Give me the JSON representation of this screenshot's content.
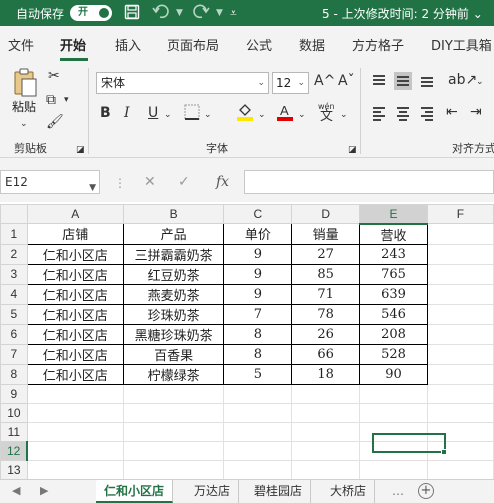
{
  "titlebar": {
    "autosave_label": "自动保存",
    "autosave_toggle": "开",
    "doc_status": "5 - 上次修改时间: 2 分钟前 ⌄"
  },
  "ribbon_tabs": [
    "文件",
    "开始",
    "插入",
    "页面布局",
    "公式",
    "数据",
    "方方格子",
    "DIY工具箱"
  ],
  "active_tab": "开始",
  "ribbon": {
    "paste_label": "粘贴",
    "clipboard_group": "剪贴板",
    "font_group": "字体",
    "align_group": "对齐方式",
    "font_name": "宋体",
    "font_size": "12",
    "increase_font": "A^",
    "decrease_font": "Aˇ",
    "bold": "B",
    "italic": "I",
    "underline": "U",
    "wen": "wén",
    "wen_char": "文",
    "font_color_letter": "A",
    "font_color": "#e00000",
    "fill_color": "#ffe600"
  },
  "formula_bar": {
    "name_box": "E12",
    "cancel": "✕",
    "confirm": "✓",
    "fx": "fx",
    "value": ""
  },
  "grid": {
    "col_headers": [
      "A",
      "B",
      "C",
      "D",
      "E",
      "F"
    ],
    "selected_col": "E",
    "selected_row": "12",
    "row_headers": [
      "1",
      "2",
      "3",
      "4",
      "5",
      "6",
      "7",
      "8",
      "9",
      "10",
      "11",
      "12",
      "13",
      "14"
    ],
    "header_row": [
      "店铺",
      "产品",
      "单价",
      "销量",
      "营收"
    ],
    "rows": [
      [
        "仁和小区店",
        "三拼霸霸奶茶",
        "9",
        "27",
        "243"
      ],
      [
        "仁和小区店",
        "红豆奶茶",
        "9",
        "85",
        "765"
      ],
      [
        "仁和小区店",
        "燕麦奶茶",
        "9",
        "71",
        "639"
      ],
      [
        "仁和小区店",
        "珍珠奶茶",
        "7",
        "78",
        "546"
      ],
      [
        "仁和小区店",
        "黑糖珍珠奶茶",
        "8",
        "26",
        "208"
      ],
      [
        "仁和小区店",
        "百香果",
        "8",
        "66",
        "528"
      ],
      [
        "仁和小区店",
        "柠檬绿茶",
        "5",
        "18",
        "90"
      ]
    ]
  },
  "sheets": [
    "仁和小区店",
    "万达店",
    "碧桂园店",
    "大桥店"
  ],
  "active_sheet": "仁和小区店",
  "colors": {
    "accent": "#217346"
  }
}
